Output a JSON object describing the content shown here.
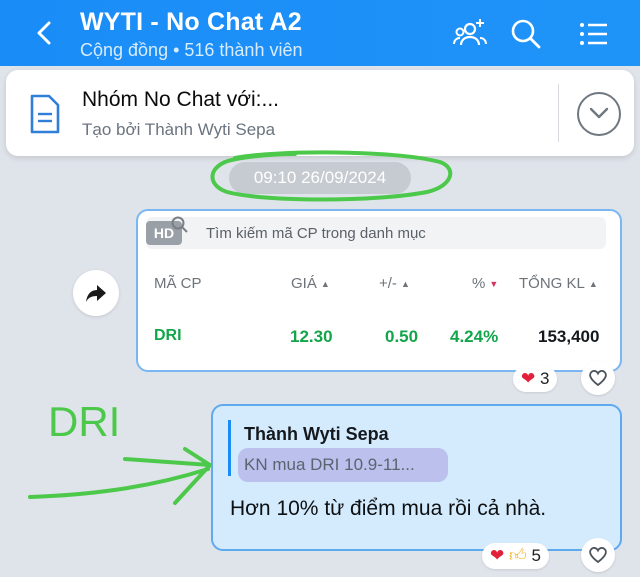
{
  "header": {
    "title": "WYTI - No Chat A2",
    "subtitle": "Cộng đồng • 516 thành viên",
    "bg_color": "#1a8cf7"
  },
  "pinned": {
    "title": "Nhóm No Chat với:...",
    "subtitle": "Tạo bởi Thành Wyti Sepa"
  },
  "timestamp": "09:10 26/09/2024",
  "stock_card": {
    "search_placeholder": "Tìm kiếm mã CP trong danh mục",
    "hd_badge": "HD",
    "columns": [
      "MÃ CP",
      "GIÁ",
      "+/-",
      "%",
      "TỔNG KL"
    ],
    "row": {
      "code": "DRI",
      "price": "12.30",
      "change": "0.50",
      "percent": "4.24%",
      "volume": "153,400"
    },
    "reaction_count": "3",
    "up_color": "#13a54a"
  },
  "reply": {
    "quote_author": "Thành Wyti Sepa",
    "quote_text": "KN mua DRI 10.9-11...",
    "message": "Hơn 10% từ điểm mua rồi cả nhà.",
    "reaction_count": "5"
  },
  "annotation": {
    "label": "DRI",
    "color": "#4cc94a"
  }
}
